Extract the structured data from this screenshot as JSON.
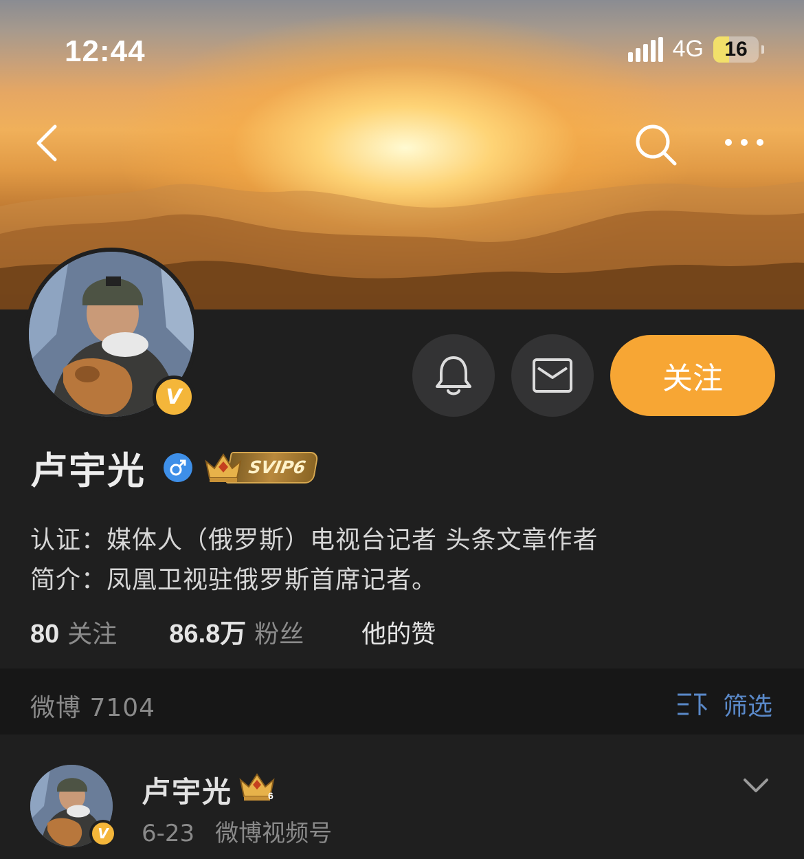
{
  "status_bar": {
    "time": "12:44",
    "network": "4G",
    "battery": "16",
    "battery_level": 0.16
  },
  "nav": {
    "back_icon": "chevron-left-icon",
    "search_icon": "search-icon",
    "more_icon": "ellipsis-icon"
  },
  "profile": {
    "name": "卢宇光",
    "verified_mark": "V",
    "gender_icon": "male-icon",
    "vip_label": "SVIP6",
    "follow_label": "关注",
    "certification": "认证：媒体人（俄罗斯）电视台记者 头条文章作者",
    "intro": "简介：凤凰卫视驻俄罗斯首席记者。",
    "stats": {
      "following_count": "80",
      "following_label": "关注",
      "followers_count": "86.8万",
      "followers_label": "粉丝",
      "likes_label": "他的赞"
    }
  },
  "posts_bar": {
    "count_text": "微博 7104",
    "filter_label": "筛选"
  },
  "first_post": {
    "author": "卢宇光",
    "crown_level": "6",
    "date": "6-23",
    "source": "微博视频号"
  },
  "colors": {
    "accent": "#f7a634",
    "background": "#1f1f1f",
    "bar_background": "#171717",
    "link_blue": "#5a89c9",
    "verified_gold": "#f4b63a",
    "gender_blue": "#3e8fe8"
  }
}
